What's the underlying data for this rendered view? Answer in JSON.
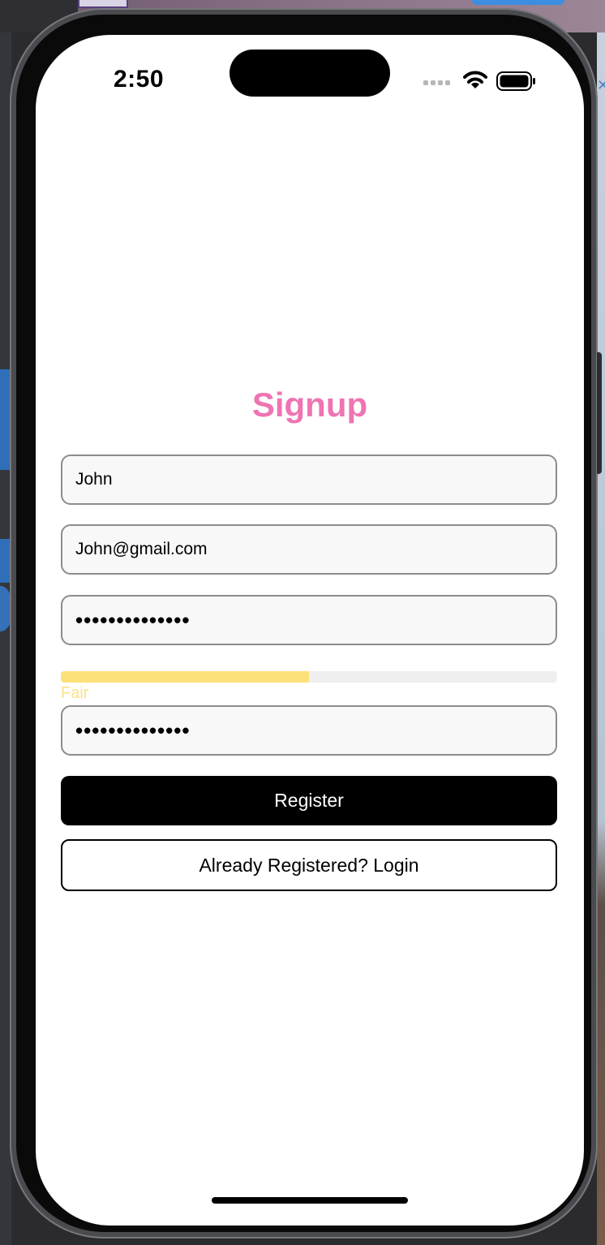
{
  "status_bar": {
    "time": "2:50",
    "icons": [
      "signal-dots-icon",
      "wifi-icon",
      "battery-icon"
    ]
  },
  "signup": {
    "title": "Signup",
    "name_value": "John",
    "email_value": "John@gmail.com",
    "password_value": "••••••••••••••",
    "password_strength": {
      "label": "Fair",
      "level": 0.5,
      "color": "#fce07a"
    },
    "confirm_password_value": "••••••••••••••",
    "register_label": "Register",
    "login_label": "Already Registered? Login"
  },
  "colors": {
    "title": "#ee74b3",
    "primary_button": "#000000",
    "field_border": "#8c8c8c"
  }
}
